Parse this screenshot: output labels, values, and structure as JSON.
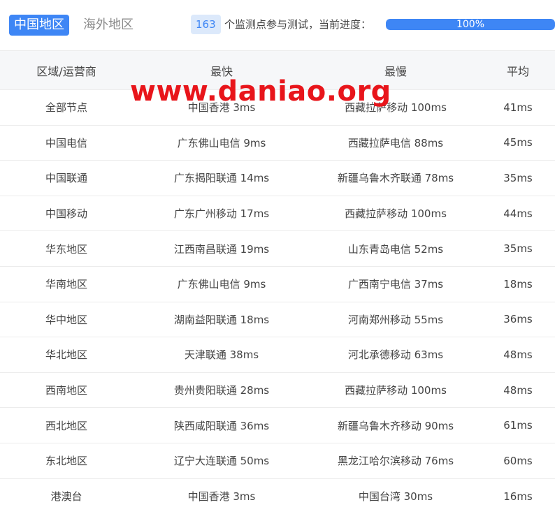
{
  "tabs": {
    "active": "中国地区",
    "inactive": "海外地区"
  },
  "progress_info": {
    "count": "163",
    "text": "个监测点参与测试，当前进度：",
    "percent_label": "100%",
    "percent": 100
  },
  "table": {
    "headers": [
      "区域/运营商",
      "最快",
      "最慢",
      "平均"
    ],
    "rows": [
      [
        "全部节点",
        "中国香港 3ms",
        "西藏拉萨移动 100ms",
        "41ms"
      ],
      [
        "中国电信",
        "广东佛山电信 9ms",
        "西藏拉萨电信 88ms",
        "45ms"
      ],
      [
        "中国联通",
        "广东揭阳联通 14ms",
        "新疆乌鲁木齐联通 78ms",
        "35ms"
      ],
      [
        "中国移动",
        "广东广州移动 17ms",
        "西藏拉萨移动 100ms",
        "44ms"
      ],
      [
        "华东地区",
        "江西南昌联通 19ms",
        "山东青岛电信 52ms",
        "35ms"
      ],
      [
        "华南地区",
        "广东佛山电信 9ms",
        "广西南宁电信 37ms",
        "18ms"
      ],
      [
        "华中地区",
        "湖南益阳联通 18ms",
        "河南郑州移动 55ms",
        "36ms"
      ],
      [
        "华北地区",
        "天津联通 38ms",
        "河北承德移动 63ms",
        "48ms"
      ],
      [
        "西南地区",
        "贵州贵阳联通 28ms",
        "西藏拉萨移动 100ms",
        "48ms"
      ],
      [
        "西北地区",
        "陕西咸阳联通 36ms",
        "新疆乌鲁木齐移动 90ms",
        "61ms"
      ],
      [
        "东北地区",
        "辽宁大连联通 50ms",
        "黑龙江哈尔滨移动 76ms",
        "60ms"
      ],
      [
        "港澳台",
        "中国香港 3ms",
        "中国台湾 30ms",
        "16ms"
      ]
    ]
  },
  "watermark": "www.daniao.org",
  "colors": {
    "accent": "#3e86f5",
    "watermark": "#e8151b"
  }
}
